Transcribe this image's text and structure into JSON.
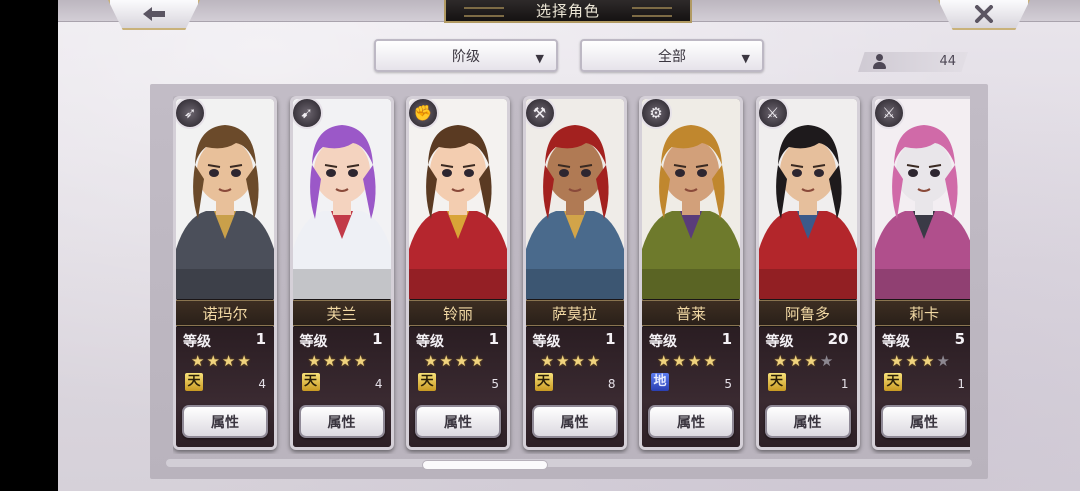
{
  "header": {
    "title": "选择角色",
    "back_icon": "back-arrow-icon",
    "close_icon": "close-x-icon"
  },
  "filters": {
    "rank_label": "阶级",
    "category_label": "全部"
  },
  "roster": {
    "count": "44",
    "icon": "user-icon"
  },
  "labels": {
    "level": "等级",
    "attribute": "属性"
  },
  "characters": [
    {
      "name": "诺玛尔",
      "level": "1",
      "stars": 4,
      "max_stars": 4,
      "rank": "天",
      "rank_color": "#e8bf3a",
      "rank_count": "4",
      "class_icon": "spear-icon",
      "hair": "#6b4a2a",
      "skin": "#e8c09a",
      "outfit": "#4b4f5a",
      "accent": "#c9a04a",
      "bg": "#f2f2f2"
    },
    {
      "name": "芙兰",
      "level": "1",
      "stars": 4,
      "max_stars": 4,
      "rank": "天",
      "rank_color": "#e8bf3a",
      "rank_count": "4",
      "class_icon": "bow-icon",
      "hair": "#9b58c8",
      "skin": "#f4d3bf",
      "outfit": "#eef0f5",
      "accent": "#c23a48",
      "bg": "#f2f2f4"
    },
    {
      "name": "铃丽",
      "level": "1",
      "stars": 4,
      "max_stars": 4,
      "rank": "天",
      "rank_color": "#e8bf3a",
      "rank_count": "5",
      "class_icon": "fist-icon",
      "hair": "#5a3a22",
      "skin": "#f3cdb0",
      "outfit": "#b5262e",
      "accent": "#d9a437",
      "bg": "#f4f2f0"
    },
    {
      "name": "萨莫拉",
      "level": "1",
      "stars": 4,
      "max_stars": 4,
      "rank": "天",
      "rank_color": "#e8bf3a",
      "rank_count": "8",
      "class_icon": "axe-icon",
      "hair": "#a3211f",
      "skin": "#b07a54",
      "outfit": "#4a6a8c",
      "accent": "#d2a449",
      "bg": "#efece8"
    },
    {
      "name": "普莱",
      "level": "1",
      "stars": 4,
      "max_stars": 4,
      "rank": "地",
      "rank_color": "#3550d6",
      "rank_count": "5",
      "class_icon": "wrench-icon",
      "hair": "#c0872e",
      "skin": "#d2a07a",
      "outfit": "#6e7a2c",
      "accent": "#5a3c7a",
      "bg": "#efece6"
    },
    {
      "name": "阿鲁多",
      "level": "20",
      "stars": 3,
      "max_stars": 4,
      "rank": "天",
      "rank_color": "#e8bf3a",
      "rank_count": "1",
      "class_icon": "sword-icon",
      "hair": "#1e1a1c",
      "skin": "#e6bf9c",
      "outfit": "#b3262b",
      "accent": "#3b5a8a",
      "bg": "#f0eeee"
    },
    {
      "name": "莉卡",
      "level": "5",
      "stars": 3,
      "max_stars": 4,
      "rank": "天",
      "rank_color": "#e8bf3a",
      "rank_count": "1",
      "class_icon": "sword-icon",
      "hair": "#d06aa8",
      "skin": "#e9e6ea",
      "outfit": "#b04f8c",
      "accent": "#3a3a46",
      "bg": "#f3eef2"
    }
  ]
}
